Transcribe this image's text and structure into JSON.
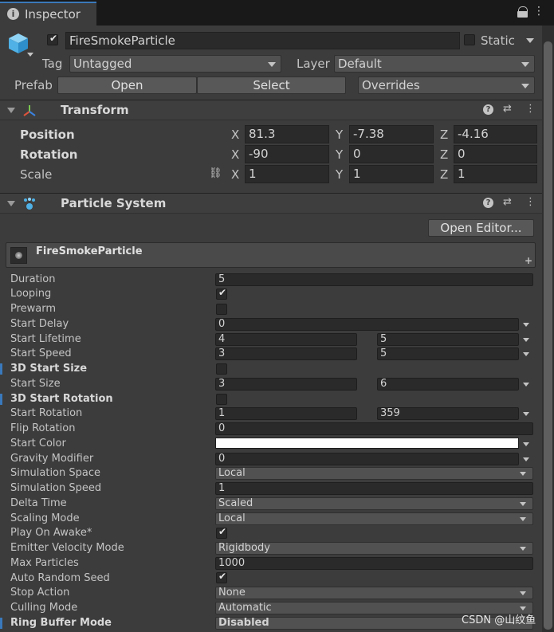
{
  "tab": {
    "title": "Inspector"
  },
  "object": {
    "name": "FireSmokeParticle",
    "static_label": "Static",
    "tag_label": "Tag",
    "tag_value": "Untagged",
    "layer_label": "Layer",
    "layer_value": "Default",
    "prefab_label": "Prefab",
    "open_label": "Open",
    "select_label": "Select",
    "overrides_label": "Overrides"
  },
  "transform": {
    "title": "Transform",
    "position_label": "Position",
    "rotation_label": "Rotation",
    "scale_label": "Scale",
    "x": "X",
    "y": "Y",
    "z": "Z",
    "position": {
      "x": "81.3",
      "y": "-7.38",
      "z": "-4.16"
    },
    "rotation": {
      "x": "-90",
      "y": "0",
      "z": "0"
    },
    "scale": {
      "x": "1",
      "y": "1",
      "z": "1"
    }
  },
  "particle": {
    "title": "Particle System",
    "open_editor": "Open Editor...",
    "module_name": "FireSmokeParticle",
    "labels": {
      "duration": "Duration",
      "looping": "Looping",
      "prewarm": "Prewarm",
      "start_delay": "Start Delay",
      "start_lifetime": "Start Lifetime",
      "start_speed": "Start Speed",
      "start_size_3d": "3D Start Size",
      "start_size": "Start Size",
      "start_rotation_3d": "3D Start Rotation",
      "start_rotation": "Start Rotation",
      "flip_rotation": "Flip Rotation",
      "start_color": "Start Color",
      "gravity_modifier": "Gravity Modifier",
      "simulation_space": "Simulation Space",
      "simulation_speed": "Simulation Speed",
      "delta_time": "Delta Time",
      "scaling_mode": "Scaling Mode",
      "play_on_awake": "Play On Awake*",
      "emitter_velocity_mode": "Emitter Velocity Mode",
      "max_particles": "Max Particles",
      "auto_random_seed": "Auto Random Seed",
      "stop_action": "Stop Action",
      "culling_mode": "Culling Mode",
      "ring_buffer_mode": "Ring Buffer Mode"
    },
    "values": {
      "duration": "5",
      "start_delay": "0",
      "start_lifetime_min": "4",
      "start_lifetime_max": "5",
      "start_speed_min": "3",
      "start_speed_max": "5",
      "start_size_min": "3",
      "start_size_max": "6",
      "start_rotation_min": "1",
      "start_rotation_max": "359",
      "flip_rotation": "0",
      "gravity_modifier": "0",
      "simulation_space": "Local",
      "simulation_speed": "1",
      "delta_time": "Scaled",
      "scaling_mode": "Local",
      "emitter_velocity_mode": "Rigidbody",
      "max_particles": "1000",
      "stop_action": "None",
      "culling_mode": "Automatic",
      "ring_buffer_mode": "Disabled"
    },
    "start_color_hex": "#ffffff"
  },
  "watermark": "CSDN @山纹鱼",
  "colors": {
    "accent": "#3a79bb",
    "panel": "#3c3c3c",
    "field": "#2a2a2a"
  }
}
